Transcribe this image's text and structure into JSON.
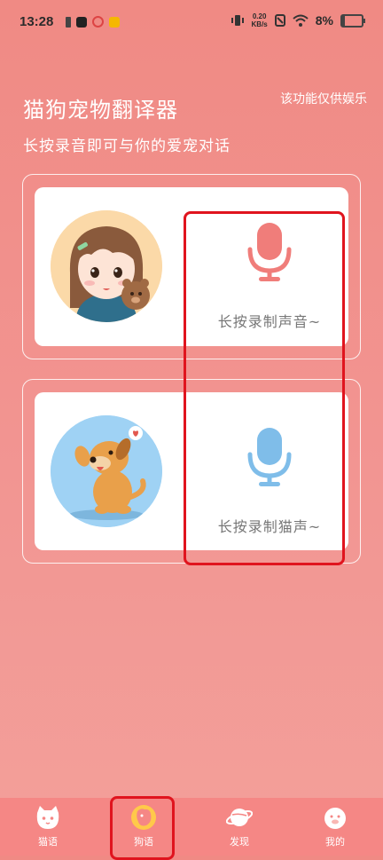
{
  "status_bar": {
    "time": "13:28",
    "net_speed_value": "0.20",
    "net_speed_unit": "KB/s",
    "battery": "8%"
  },
  "header": {
    "title": "猫狗宠物翻译器",
    "disclaimer": "该功能仅供娱乐",
    "subtitle": "长按录音即可与你的爱宠对话"
  },
  "cards": [
    {
      "avatar": "girl-with-teddy-avatar",
      "label": "长按录制声音~",
      "mic_color": "#f07d7a"
    },
    {
      "avatar": "puppy-avatar",
      "label": "长按录制猫声~",
      "mic_color": "#7fbde9"
    }
  ],
  "bottom_nav": {
    "items": [
      {
        "label": "猫语",
        "icon": "cat-face-icon"
      },
      {
        "label": "狗语",
        "icon": "dog-face-icon"
      },
      {
        "label": "发现",
        "icon": "planet-icon"
      },
      {
        "label": "我的",
        "icon": "pig-face-icon"
      }
    ],
    "active": "狗语"
  },
  "colors": {
    "background": "#f08a84",
    "nav_background": "#f58785",
    "highlight": "#e0141e",
    "mic_human": "#f07d7a",
    "mic_cat": "#7fbde9"
  }
}
